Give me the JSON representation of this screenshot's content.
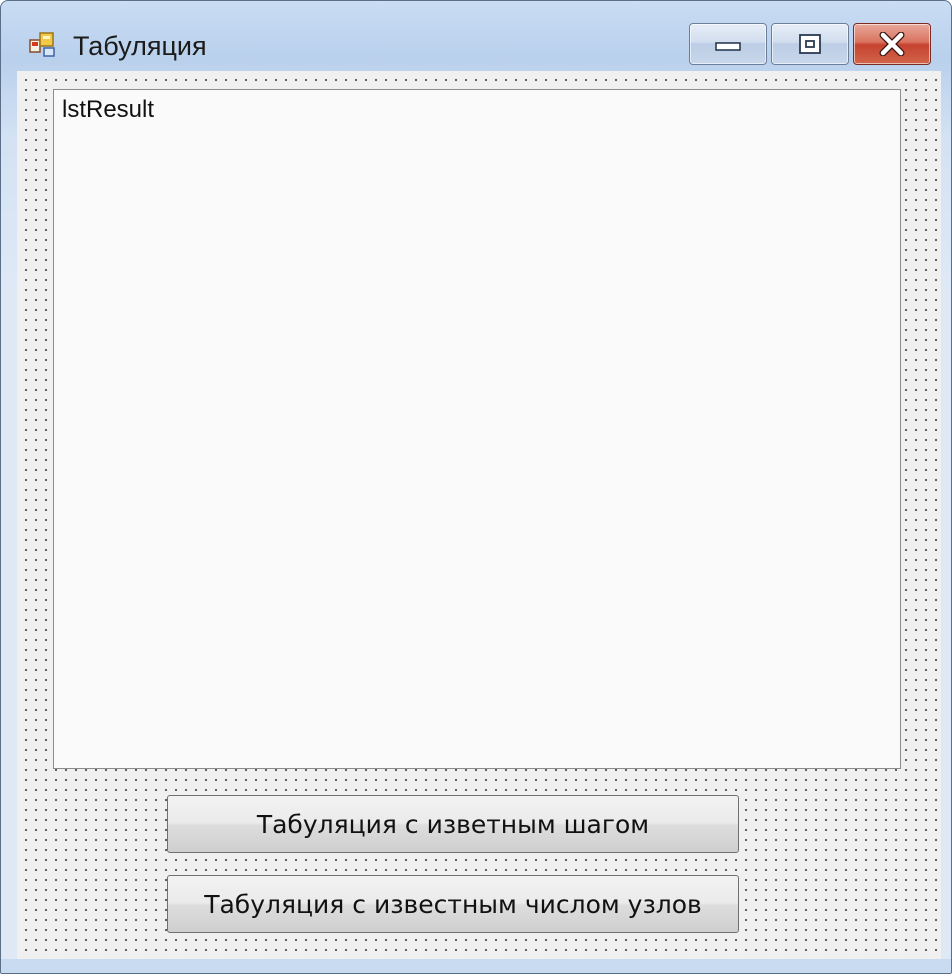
{
  "window": {
    "title": "Табуляция",
    "icon": "form-icon",
    "controls": {
      "minimize_icon": "minimize-icon",
      "maximize_icon": "restore-icon",
      "close_icon": "close-icon"
    },
    "accent_color": "#c54330"
  },
  "form": {
    "listbox": {
      "name": "lstResult"
    },
    "buttons": [
      {
        "label": "Табуляция с изветным шагом"
      },
      {
        "label": "Табуляция с известным числом узлов"
      }
    ]
  }
}
